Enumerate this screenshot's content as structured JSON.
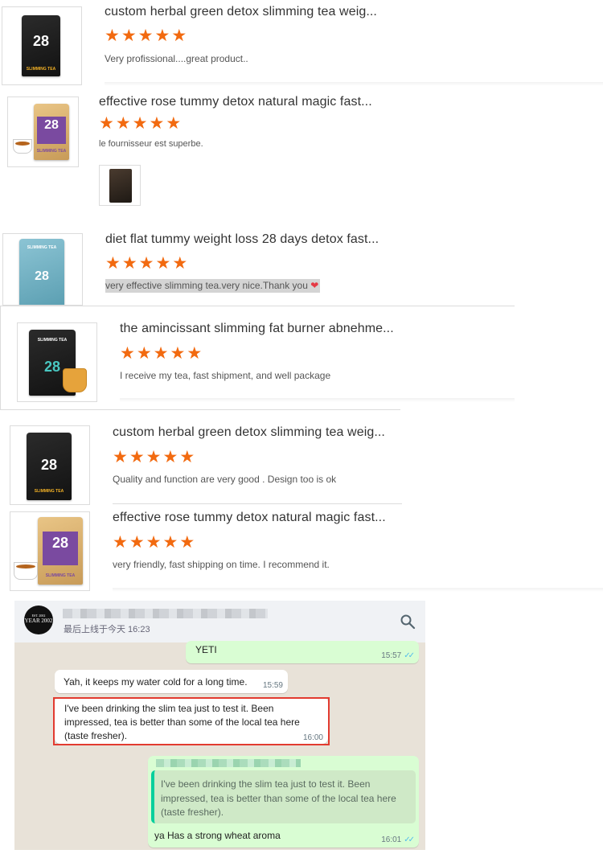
{
  "reviews": [
    {
      "title": "custom herbal green detox slimming tea weig...",
      "stars": 5,
      "comment": "Very profissional....great product..",
      "bag_number": "28",
      "bag_label": "SLIMMING TEA"
    },
    {
      "title": "effective rose tummy detox natural magic fast...",
      "stars": 5,
      "comment": "le fournisseur est superbe.",
      "bag_number": "28",
      "bag_label": "SLIMMING TEA"
    },
    {
      "title": "diet flat tummy weight loss 28 days detox fast...",
      "stars": 5,
      "comment": "very effective slimming tea.very nice.Thank you",
      "bag_number": "28",
      "bag_label": "SLIMMING TEA"
    },
    {
      "title": "the amincissant slimming fat burner abnehme...",
      "stars": 5,
      "comment": "I receive my tea, fast shipment, and well package",
      "bag_number": "28",
      "bag_label": "SLIMMING TEA"
    },
    {
      "title": "custom herbal green detox slimming tea weig...",
      "stars": 5,
      "comment": "Quality and function are very good . Design too is ok",
      "bag_number": "28",
      "bag_label": "SLIMMING TEA"
    },
    {
      "title": "effective rose tummy detox natural magic fast...",
      "stars": 5,
      "comment": "very friendly, fast shipping on time. I recommend it.",
      "bag_number": "28",
      "bag_label": "SLIMMING TEA"
    }
  ],
  "chat": {
    "avatar_line1": "EST. 2002",
    "avatar_line2": "YEAR 2002",
    "last_seen": "最后上线于今天 16:23",
    "messages": [
      {
        "direction": "out",
        "text": "YETI",
        "time": "15:57"
      },
      {
        "direction": "in",
        "text": "Yah, it keeps my water cold for a long time.",
        "time": "15:59"
      },
      {
        "direction": "in",
        "text": "I've been drinking the slim tea just to test it. Been impressed, tea is better than some of the local tea here (taste fresher).",
        "time": "16:00"
      },
      {
        "direction": "out",
        "quote": "I've been drinking the slim tea just to test it. Been impressed, tea is better than some of the local tea here (taste fresher).",
        "text": "ya Has a strong wheat aroma",
        "time": "16:01"
      }
    ]
  },
  "colors": {
    "star": "#f26a10",
    "highlight_box": "#e23b30",
    "bubble_out": "#d9fdd3",
    "bubble_in": "#ffffff",
    "chat_bg": "#e8e2d8",
    "read_ticks": "#53bdeb"
  }
}
